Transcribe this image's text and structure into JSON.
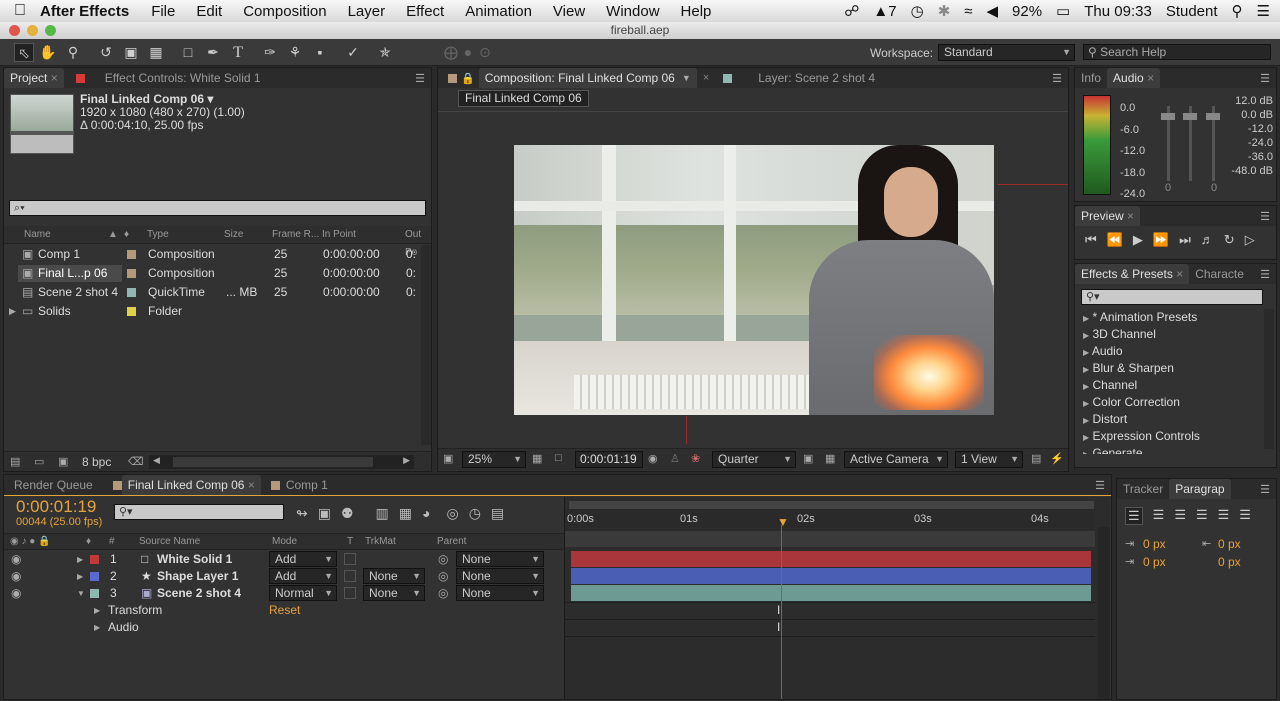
{
  "menubar": {
    "app": "After Effects",
    "items": [
      "File",
      "Edit",
      "Composition",
      "Layer",
      "Effect",
      "Animation",
      "View",
      "Window",
      "Help"
    ],
    "adobe_count": "7",
    "battery": "92%",
    "clock": "Thu 09:33",
    "user": "Student"
  },
  "window": {
    "title": "fireball.aep"
  },
  "toolbar": {
    "workspace_label": "Workspace:",
    "workspace_value": "Standard",
    "search_placeholder": "Search Help"
  },
  "project": {
    "tab": "Project",
    "effect_tab": "Effect Controls: White Solid 1",
    "comp_name": "Final Linked Comp 06 ▾",
    "comp_res": "1920 x 1080  (480 x 270) (1.00)",
    "comp_dur": "Δ 0:00:04:10, 25.00 fps",
    "search": "⌕▾",
    "columns": [
      "Name",
      "Type",
      "Size",
      "Frame R...",
      "In Point",
      "Out Po"
    ],
    "items": [
      {
        "name": "Comp 1",
        "type": "Composition",
        "size": "",
        "fps": "25",
        "in": "0:00:00:00",
        "out": "0:",
        "color": "#b49a7a"
      },
      {
        "name": "Final L...p 06",
        "type": "Composition",
        "size": "",
        "fps": "25",
        "in": "0:00:00:00",
        "out": "0:",
        "color": "#b49a7a"
      },
      {
        "name": "Scene 2 shot 4",
        "type": "QuickTime",
        "size": "... MB",
        "fps": "25",
        "in": "0:00:00:00",
        "out": "0:",
        "color": "#8fb8b0"
      },
      {
        "name": "Solids",
        "type": "Folder",
        "size": "",
        "fps": "",
        "in": "",
        "out": "",
        "color": "#e2d04a"
      }
    ],
    "bpc": "8 bpc"
  },
  "comp": {
    "tab": "Composition: Final Linked Comp 06",
    "layer_tab": "Layer: Scene 2 shot 4",
    "breadcrumb": "Final Linked Comp 06",
    "zoom": "25%",
    "time": "0:00:01:19",
    "resolution": "Quarter",
    "camera": "Active Camera",
    "views": "1 View"
  },
  "info": {
    "tab": "Info",
    "audio_tab": "Audio",
    "left_scale": [
      "0.0",
      "-6.0",
      "-12.0",
      "-18.0",
      "-24.0"
    ],
    "right_scale": [
      "12.0 dB",
      "0.0 dB",
      "-12.0",
      "-24.0",
      "-36.0",
      "-48.0 dB"
    ],
    "sliders": [
      "0",
      "0"
    ]
  },
  "preview": {
    "tab": "Preview"
  },
  "effects": {
    "tab": "Effects & Presets",
    "char_tab": "Characte",
    "items": [
      "* Animation Presets",
      "3D Channel",
      "Audio",
      "Blur & Sharpen",
      "Channel",
      "Color Correction",
      "Distort",
      "Expression Controls",
      "Generate"
    ]
  },
  "timeline": {
    "tabs": [
      "Render Queue",
      "Final Linked Comp 06",
      "Comp 1"
    ],
    "time": "0:00:01:19",
    "frames": "00044 (25.00 fps)",
    "headers": [
      "#",
      "Source Name",
      "Mode",
      "T",
      "TrkMat",
      "Parent"
    ],
    "layers": [
      {
        "num": "1",
        "name": "White Solid 1",
        "mode": "Add",
        "trkmat": "",
        "parent": "None",
        "color": "#c0393a",
        "icon": "□",
        "barcolor": "#a8363b"
      },
      {
        "num": "2",
        "name": "Shape Layer 1",
        "mode": "Add",
        "trkmat": "None",
        "parent": "None",
        "color": "#5a6ad0",
        "icon": "★",
        "barcolor": "#4a5fb4"
      },
      {
        "num": "3",
        "name": "Scene 2 shot 4",
        "mode": "Normal",
        "trkmat": "None",
        "parent": "None",
        "color": "#8fb8b0",
        "icon": "▣",
        "barcolor": "#6d9a92"
      }
    ],
    "sub": [
      {
        "name": "Transform",
        "value": "Reset"
      },
      {
        "name": "Audio",
        "value": ""
      }
    ],
    "ruler": [
      "0:00s",
      "01s",
      "02s",
      "03s",
      "04s"
    ],
    "playhead": "0:00:01:19"
  },
  "side": {
    "tracker_tab": "Tracker",
    "para_tab": "Paragrap",
    "px_values": [
      "0 px",
      "0 px",
      "0 px",
      "0 px"
    ]
  }
}
